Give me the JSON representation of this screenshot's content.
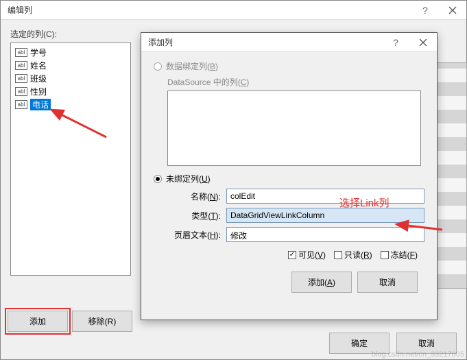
{
  "outer": {
    "title": "编辑列",
    "section_label": "选定的列(C):",
    "columns": [
      {
        "icon": "abl",
        "name": "学号"
      },
      {
        "icon": "abl",
        "name": "姓名"
      },
      {
        "icon": "abl",
        "name": "班级"
      },
      {
        "icon": "abl",
        "name": "性别"
      },
      {
        "icon": "abl",
        "name": "电话"
      }
    ],
    "add_button": "添加",
    "remove_button": "移除(R)",
    "ok_button": "确定",
    "cancel_button": "取消"
  },
  "inner": {
    "title": "添加列",
    "help_glyph": "?",
    "bound_radio": "数据绑定列(B)",
    "datasource_label": "DataSource 中的列(C)",
    "unbound_radio": "未绑定列(U)",
    "name_label": "名称(N):",
    "name_value": "colEdit",
    "type_label": "类型(T):",
    "type_value": "DataGridViewLinkColumn",
    "header_label": "页眉文本(H):",
    "header_value": "修改",
    "visible_chk": "可见(V)",
    "readonly_chk": "只读(R)",
    "frozen_chk": "冻结(F)",
    "add_button": "添加(A)",
    "cancel_button": "取消"
  },
  "annotation": {
    "text": "选择Link列"
  },
  "watermark": "blog.csdn.net/cn_33217005"
}
